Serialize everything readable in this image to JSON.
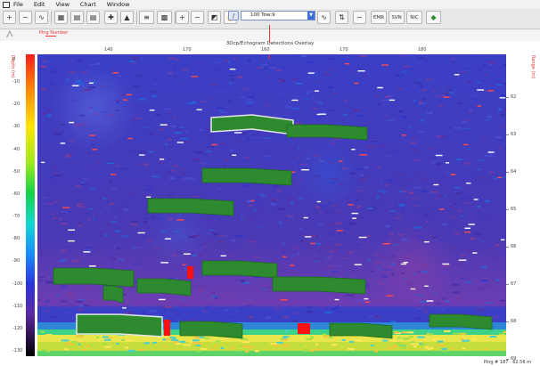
{
  "menu": {
    "items": [
      "File",
      "Edit",
      "View",
      "Chart",
      "Window"
    ]
  },
  "toolbar": {
    "buttons": [
      {
        "name": "add-layer-icon",
        "glyph": "+"
      },
      {
        "name": "trace-icon",
        "glyph": "~"
      },
      {
        "name": "grid-icon",
        "glyph": "▦"
      },
      {
        "name": "table-icon",
        "glyph": "▤"
      },
      {
        "name": "crosshair-icon",
        "glyph": "✚"
      },
      {
        "name": "histogram-icon",
        "glyph": "▲"
      },
      {
        "name": "bars-icon",
        "glyph": "≡"
      },
      {
        "name": "matrix-icon",
        "glyph": "▩"
      },
      {
        "name": "zoom-in-icon",
        "glyph": "+"
      },
      {
        "name": "zoom-out-icon",
        "glyph": "−"
      },
      {
        "name": "select-icon",
        "glyph": "◩"
      },
      {
        "name": "pan-hand-icon",
        "glyph": "✋"
      },
      {
        "name": "draw-line-icon",
        "glyph": "/"
      },
      {
        "name": "curve-icon",
        "glyph": "∿"
      },
      {
        "name": "thresholds-icon",
        "glyph": "⇅"
      },
      {
        "name": "fish-icon",
        "glyph": "◆"
      }
    ],
    "combo_value": "100 Tow:9",
    "text_buttons": [
      "EMR",
      "SVN",
      "NIC"
    ]
  },
  "subbar": {
    "ref_label": "Ping Number"
  },
  "chart": {
    "title": "3Dcp/Echogram Detections Overlay",
    "left_axis_title": "Depth (m)",
    "right_axis_title": "Range (m)",
    "x_ticks": [
      "140",
      "170",
      "160",
      "170",
      "180"
    ],
    "y_ticks": [
      "0",
      "-10",
      "-20",
      "-30",
      "-40",
      "-50",
      "-60",
      "-70",
      "-80",
      "-90",
      "-100",
      "-110",
      "-120",
      "-130"
    ],
    "right_ticks": [
      "62",
      "63",
      "64",
      "65",
      "66",
      "67",
      "68",
      "69"
    ],
    "status": "Ping # 187 · 62.56 m"
  },
  "colors": {
    "background": "#3a3fc6",
    "detection": "#2e8a2e",
    "detection_border": "#e6e6e6",
    "marker": "#e63333",
    "seabed": "#d7e74a"
  },
  "detections": [
    {
      "x": 195,
      "y": 68,
      "w": 92,
      "h": 16,
      "ox": 3,
      "selected": true
    },
    {
      "x": 280,
      "y": 79,
      "w": 90,
      "h": 14,
      "ox": 0,
      "selected": false
    },
    {
      "x": 185,
      "y": 128,
      "w": 100,
      "h": 16,
      "ox": 0,
      "selected": false
    },
    {
      "x": 124,
      "y": 162,
      "w": 96,
      "h": 16,
      "ox": 0,
      "selected": false
    },
    {
      "x": 18,
      "y": 240,
      "w": 90,
      "h": 18,
      "ox": 0,
      "selected": false
    },
    {
      "x": 112,
      "y": 252,
      "w": 60,
      "h": 16,
      "ox": 0,
      "selected": false
    },
    {
      "x": 185,
      "y": 232,
      "w": 84,
      "h": 16,
      "ox": 0,
      "selected": false
    },
    {
      "x": 264,
      "y": 250,
      "w": 104,
      "h": 16,
      "ox": 0,
      "selected": false
    },
    {
      "x": 74,
      "y": 260,
      "w": 22,
      "h": 16,
      "ox": 0,
      "selected": false
    },
    {
      "x": 44,
      "y": 292,
      "w": 96,
      "h": 22,
      "ox": 0,
      "selected": true
    },
    {
      "x": 160,
      "y": 300,
      "w": 70,
      "h": 16,
      "ox": 0,
      "selected": false
    },
    {
      "x": 328,
      "y": 302,
      "w": 70,
      "h": 14,
      "ox": 0,
      "selected": false
    },
    {
      "x": 440,
      "y": 292,
      "w": 70,
      "h": 14,
      "ox": 0,
      "selected": false
    }
  ],
  "red_marks": [
    {
      "x": 168,
      "y": 238,
      "w": 7,
      "h": 14
    },
    {
      "x": 142,
      "y": 298,
      "w": 7,
      "h": 18
    },
    {
      "x": 292,
      "y": 302,
      "w": 14,
      "h": 12
    }
  ]
}
